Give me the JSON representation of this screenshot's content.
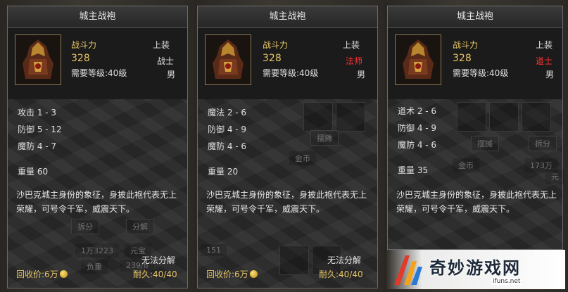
{
  "panels": [
    {
      "title": "城主战袍",
      "power_label": "战斗力",
      "power_value": "328",
      "slot_type": "上装",
      "class": "战士",
      "level_req": "需要等级:40级",
      "gender": "男",
      "stat1": "攻击 1 - 3",
      "stat2": "防御 5 - 12",
      "stat3": "魔防 4 - 7",
      "weight": "重量 60",
      "description": "沙巴克城主身份的象征，身披此袍代表无上荣耀，可号令千军，威震天下。",
      "unsellable": "无法分解",
      "recycle": "回收价:6万",
      "durability": "耐久:40/40",
      "bg_split": "拆分",
      "bg_decompose": "分解",
      "bg_gold": "1万3223",
      "bg_yuanbao": "元宝",
      "bg_weight": "负重",
      "bg_weight_val": "239/8"
    },
    {
      "title": "城主战袍",
      "power_label": "战斗力",
      "power_value": "328",
      "slot_type": "上装",
      "class": "法师",
      "level_req": "需要等级:40级",
      "gender": "男",
      "stat1": "魔法 2 - 6",
      "stat2": "防御 4 - 9",
      "stat3": "魔防 4 - 6",
      "weight": "重量 20",
      "description": "沙巴克城主身份的象征，身披此袍代表无上荣耀，可号令千军，威震天下。",
      "unsellable": "无法分解",
      "recycle": "回收价:6万",
      "durability": "耐久:40/40",
      "bg_stall": "摆摊",
      "bg_gold": "金币",
      "bg_num": "151"
    },
    {
      "title": "城主战袍",
      "power_label": "战斗力",
      "power_value": "328",
      "slot_type": "上装",
      "class": "道士",
      "level_req": "需要等级:40级",
      "gender": "男",
      "stat1": "道术 2 - 6",
      "stat2": "防御 4 - 9",
      "stat3": "魔防 4 - 6",
      "weight": "重量 35",
      "description": "沙巴克城主身份的象征，身披此袍代表无上荣耀，可号令千军，威震天下。",
      "bg_stall": "摆摊",
      "bg_split": "拆分",
      "bg_gold": "金币",
      "bg_gold_val": "173万",
      "bg_tail": "元"
    }
  ],
  "watermark": {
    "title": "奇妙游戏网",
    "url": "ifuns.net"
  },
  "colors": {
    "gold": "#e6c466",
    "class_red": "#ff3030",
    "panel_bg": "#1f1f1f"
  }
}
